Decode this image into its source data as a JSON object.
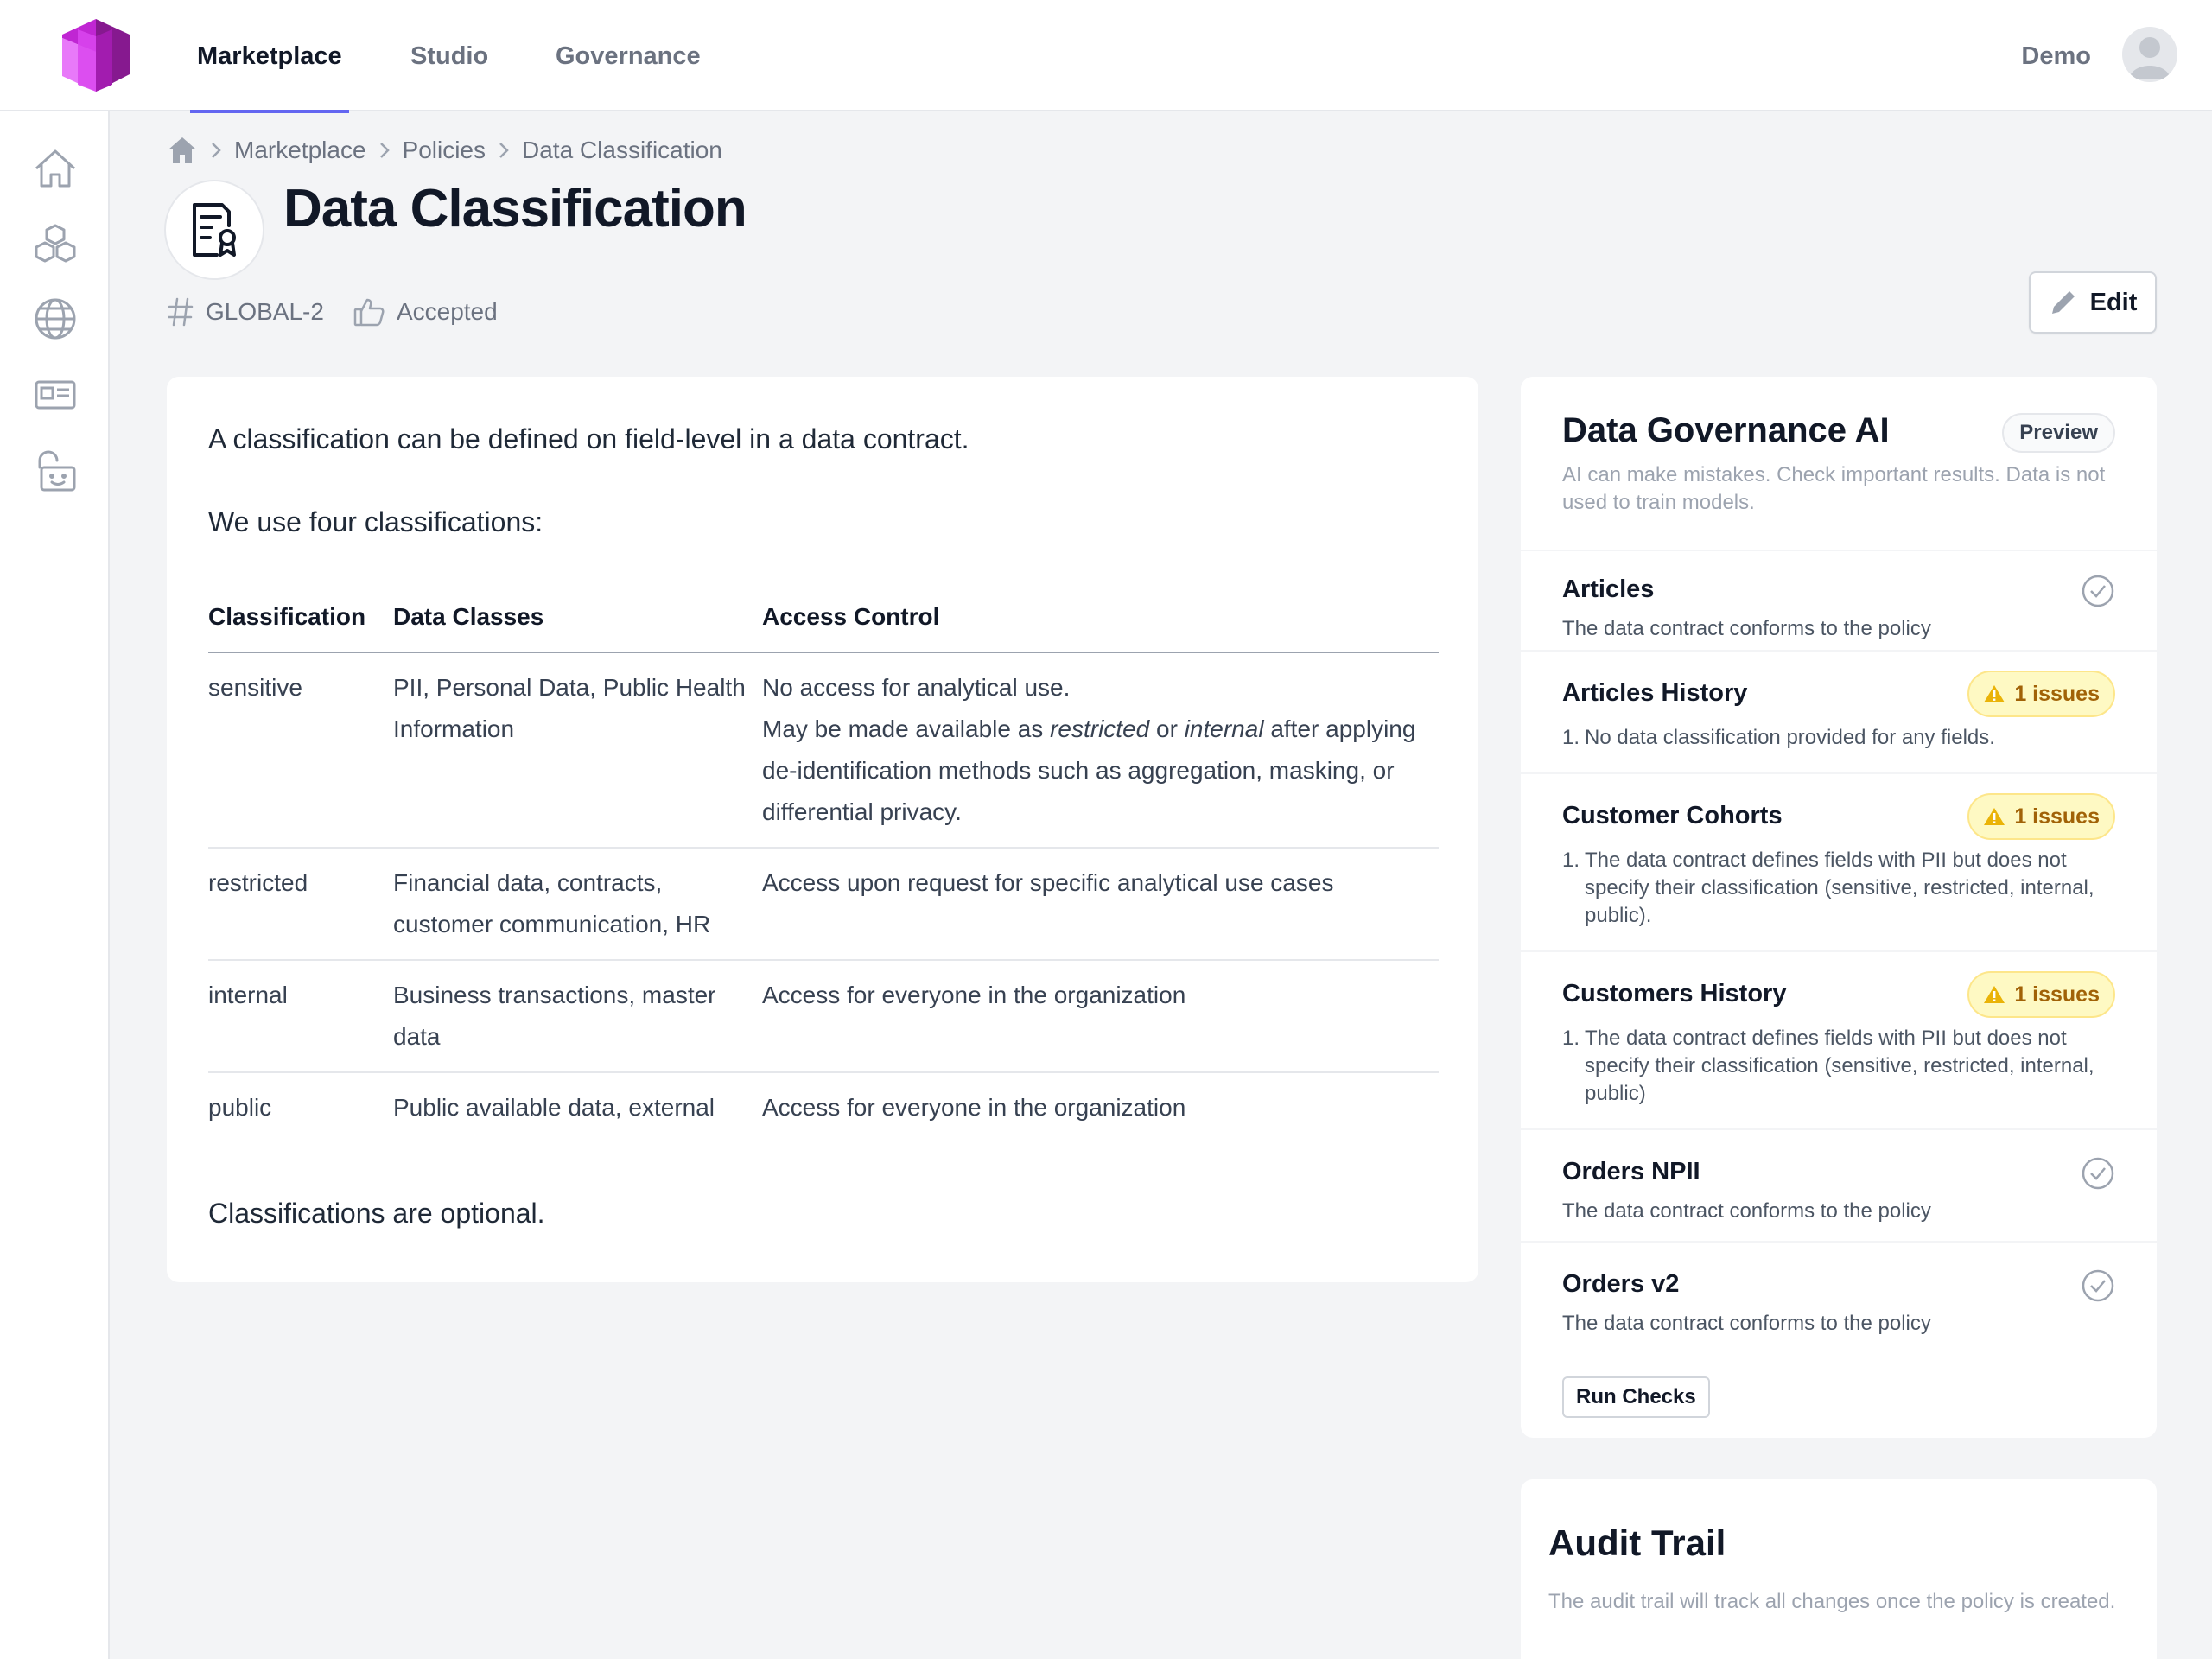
{
  "topbar": {
    "tabs": [
      {
        "label": "Marketplace",
        "active": true
      },
      {
        "label": "Studio",
        "active": false
      },
      {
        "label": "Governance",
        "active": false
      }
    ],
    "user_name": "Demo"
  },
  "sidebar": {
    "items": [
      {
        "icon": "home-icon"
      },
      {
        "icon": "cubes-icon"
      },
      {
        "icon": "globe-icon"
      },
      {
        "icon": "id-card-icon"
      },
      {
        "icon": "unlock-icon"
      }
    ]
  },
  "breadcrumb": {
    "items": [
      "Marketplace",
      "Policies",
      "Data Classification"
    ]
  },
  "header": {
    "title": "Data Classification",
    "policy_id": "GLOBAL-2",
    "status": "Accepted",
    "edit_label": "Edit"
  },
  "policy": {
    "intro": "A classification can be defined on field-level in a data contract.",
    "lead": "We use four classifications:",
    "table": {
      "headers": [
        "Classification",
        "Data Classes",
        "Access Control"
      ],
      "rows": [
        {
          "classification": "sensitive",
          "data_classes": "PII, Personal Data, Public Health Information",
          "access_line1": "No access for analytical use.",
          "access_pre": "May be made available as",
          "access_em1": "restricted",
          "access_or": "or",
          "access_em2": "internal",
          "access_post": "after applying de-identification methods such as aggregation, masking, or differential privacy."
        },
        {
          "classification": "restricted",
          "data_classes": "Financial data, contracts, customer communication, HR",
          "access": "Access upon request for specific analytical use cases"
        },
        {
          "classification": "internal",
          "data_classes": "Business transactions, master data",
          "access": "Access for everyone in the organization"
        },
        {
          "classification": "public",
          "data_classes": "Public available data, external",
          "access": "Access for everyone in the organization"
        }
      ]
    },
    "footer": "Classifications are optional."
  },
  "ai": {
    "title": "Data Governance AI",
    "badge": "Preview",
    "subtitle": "AI can make mistakes. Check important results. Data is not used to train models.",
    "contracts": [
      {
        "name": "Articles",
        "status": "ok",
        "description": "The data contract conforms to the policy"
      },
      {
        "name": "Articles History",
        "status": "issues",
        "badge": "1 issues",
        "issues": [
          "No data classification provided for any fields."
        ]
      },
      {
        "name": "Customer Cohorts",
        "status": "issues",
        "badge": "1 issues",
        "issues": [
          "The data contract defines fields with PII but does not specify their classification (sensitive, restricted, internal, public)."
        ]
      },
      {
        "name": "Customers History",
        "status": "issues",
        "badge": "1 issues",
        "issues": [
          "The data contract defines fields with PII but does not specify their classification (sensitive, restricted, internal, public)"
        ]
      },
      {
        "name": "Orders NPII",
        "status": "ok",
        "description": "The data contract conforms to the policy"
      },
      {
        "name": "Orders v2",
        "status": "ok",
        "description": "The data contract conforms to the policy"
      }
    ],
    "run_label": "Run Checks"
  },
  "audit": {
    "title": "Audit Trail",
    "subtitle": "The audit trail will track all changes once the policy is created."
  },
  "colors": {
    "accent": "#6366f1",
    "logo_light": "#e879f9",
    "logo_dark": "#86198f",
    "warning_bg": "#fef9c3",
    "warning_text": "#a16207"
  }
}
